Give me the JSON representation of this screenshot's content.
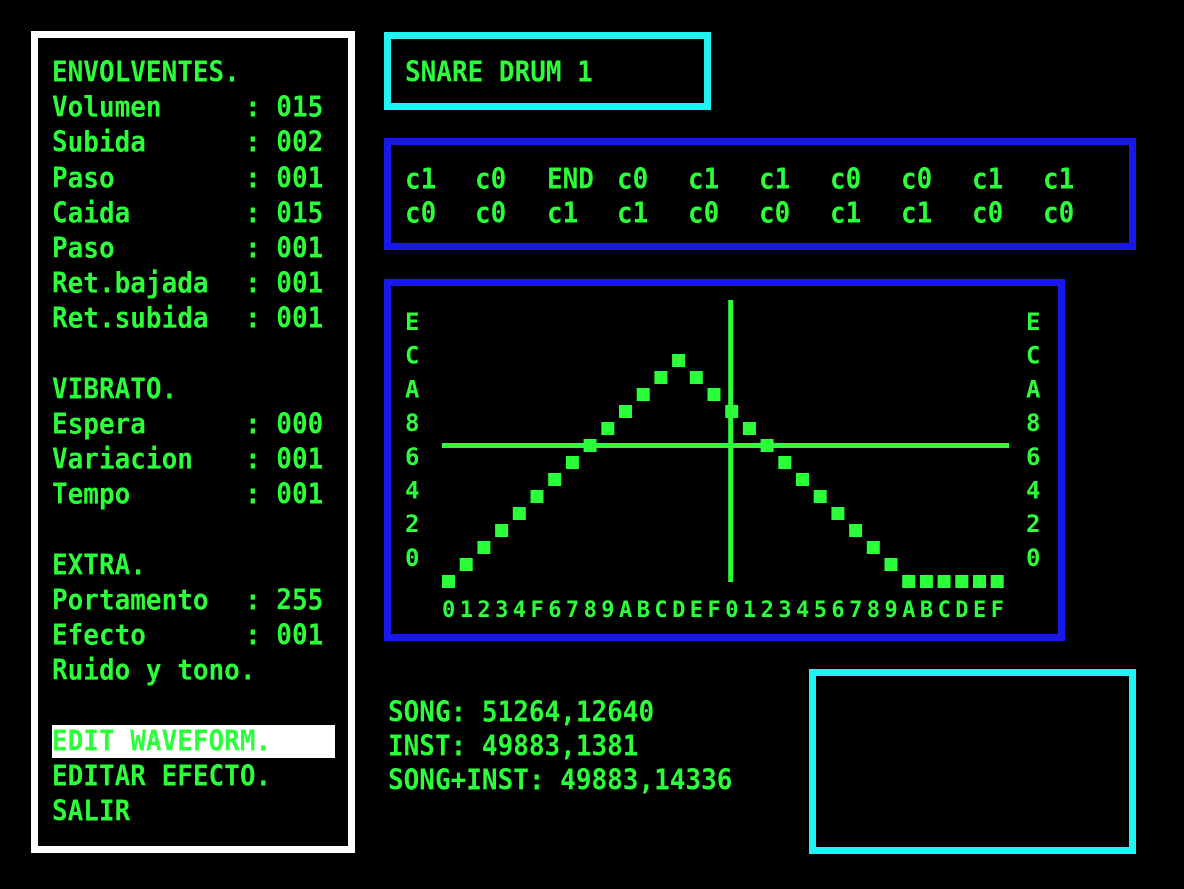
{
  "menu": {
    "envelopes_title": "ENVOLVENTES.",
    "envelopes": [
      {
        "label": "Volumen     ",
        "value": ": 015"
      },
      {
        "label": "Subida      ",
        "value": ": 002"
      },
      {
        "label": "Paso        ",
        "value": ": 001"
      },
      {
        "label": "Caida       ",
        "value": ": 015"
      },
      {
        "label": "Paso        ",
        "value": ": 001"
      },
      {
        "label": "Ret.bajada  ",
        "value": ": 001"
      },
      {
        "label": "Ret.subida  ",
        "value": ": 001"
      }
    ],
    "vibrato_title": "VIBRATO.",
    "vibrato": [
      {
        "label": "Espera      ",
        "value": ": 000"
      },
      {
        "label": "Variacion   ",
        "value": ": 001"
      },
      {
        "label": "Tempo       ",
        "value": ": 001"
      }
    ],
    "extra_title": "EXTRA.",
    "extra": [
      {
        "label": "Portamento  ",
        "value": ": 255"
      },
      {
        "label": "Efecto      ",
        "value": ": 001"
      }
    ],
    "noise_line": "Ruido y tono.",
    "actions": [
      "EDIT WAVEFORM.",
      "EDITAR EFECTO.",
      "SALIR"
    ]
  },
  "instrument_name": "SNARE DRUM 1",
  "sequence": {
    "row1": [
      "c1",
      "c0",
      "END",
      "c0",
      "c1",
      "c1",
      "c0",
      "c0",
      "c1",
      "c1"
    ],
    "row2": [
      "c0",
      "c0",
      "c1",
      "c1",
      "c0",
      "c0",
      "c1",
      "c1",
      "c0",
      "c0"
    ]
  },
  "chart_data": {
    "type": "scatter",
    "y_tick_labels": [
      "E",
      "C",
      "A",
      "8",
      "6",
      "4",
      "2",
      "0"
    ],
    "x_tick_labels": "01234F6789ABCDEF0123456789ABCDEF",
    "ylim": [
      0,
      15
    ],
    "values": [
      0,
      1,
      2,
      3,
      4,
      5,
      6,
      7,
      8,
      9,
      10,
      11,
      12,
      13,
      12,
      11,
      10,
      9,
      8,
      7,
      6,
      5,
      4,
      3,
      2,
      1,
      0,
      0,
      0,
      0,
      0,
      0,
      0,
      0,
      0,
      0
    ],
    "horizontal_marker": 8,
    "vertical_marker_index": 16
  },
  "memory": {
    "song": "SONG: 51264,12640",
    "inst": "INST: 49883,1381",
    "song_inst": "SONG+INST: 49883,14336"
  },
  "colors": {
    "text_green": "#2bff3a",
    "white": "#ffffff",
    "cyan": "#22f2f2",
    "blue": "#1818ee",
    "background": "#000000"
  }
}
